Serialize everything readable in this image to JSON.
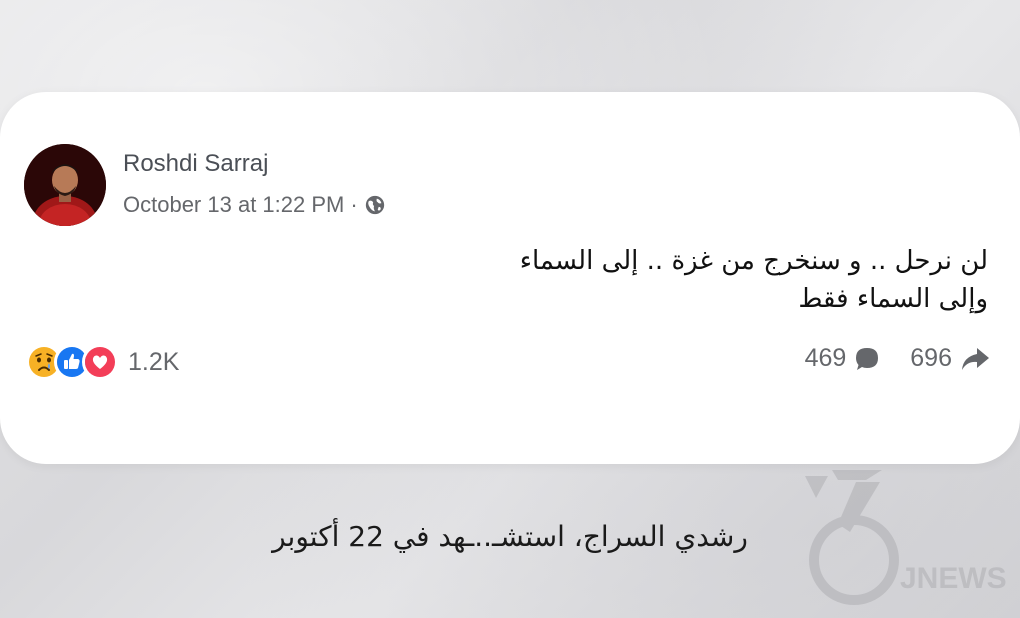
{
  "post": {
    "author": "Roshdi Sarraj",
    "timestamp": "October 13 at 1:22 PM",
    "separator": "·",
    "privacy_icon": "globe-icon",
    "text_lines": [
      "لن نرحل .. و سنخرج من غزة .. إلى السماء",
      "وإلى السماء فقط"
    ],
    "reaction_icons": [
      "sad-reaction-icon",
      "like-reaction-icon",
      "love-reaction-icon"
    ],
    "reaction_count": "1.2K",
    "comment_count": "469",
    "share_count": "696"
  },
  "caption": "رشدي السراج، استشـ..ـهد في 22 أكتوبر",
  "watermark": {
    "text": "JNEWS",
    "icon": "logo-watermark"
  },
  "colors": {
    "like_blue": "#1877f2",
    "love_red": "#f33e58",
    "sad_yellow": "#f7b125",
    "secondary_text": "#65676b"
  }
}
